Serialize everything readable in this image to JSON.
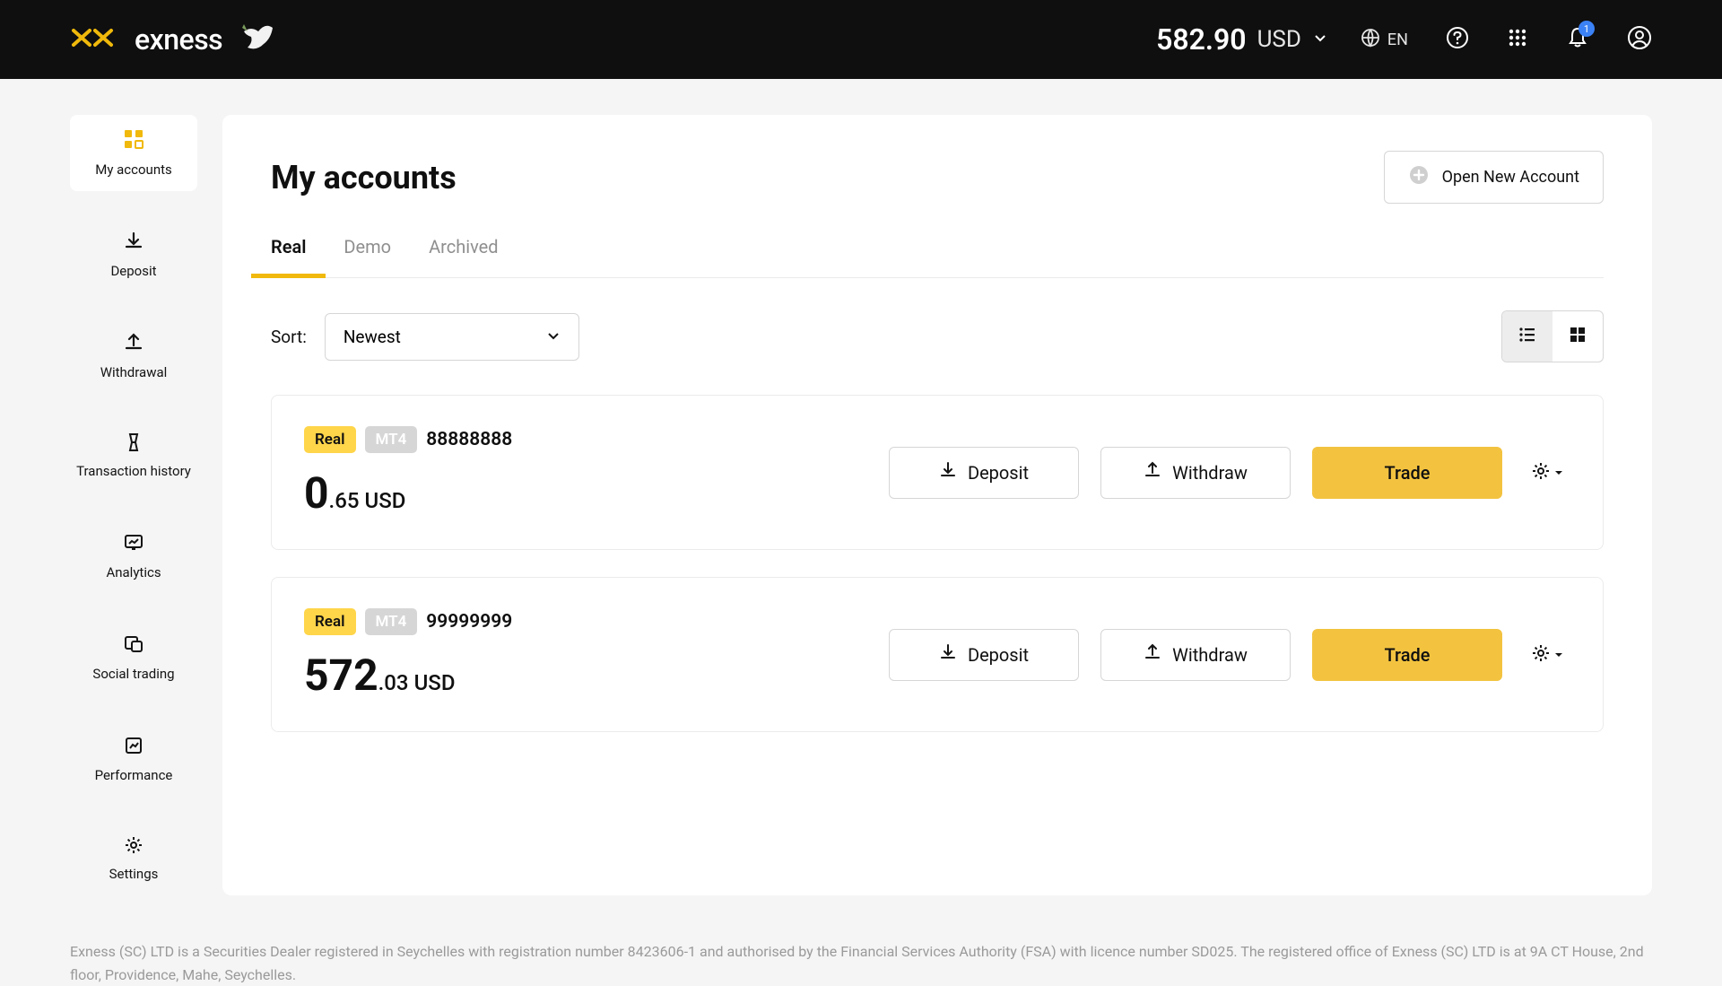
{
  "header": {
    "brand": "exness",
    "balance_amount": "582.90",
    "balance_currency": "USD",
    "lang": "EN",
    "notif_count": "1"
  },
  "sidebar": {
    "items": [
      {
        "label": "My accounts"
      },
      {
        "label": "Deposit"
      },
      {
        "label": "Withdrawal"
      },
      {
        "label": "Transaction history"
      },
      {
        "label": "Analytics"
      },
      {
        "label": "Social trading"
      },
      {
        "label": "Performance"
      },
      {
        "label": "Settings"
      }
    ]
  },
  "page": {
    "title": "My accounts",
    "open_new": "Open New Account",
    "tabs": [
      "Real",
      "Demo",
      "Archived"
    ],
    "sort_label": "Sort:",
    "sort_value": "Newest"
  },
  "accounts": [
    {
      "type_tag": "Real",
      "platform_tag": "MT4",
      "id": "88888888",
      "balance_int": "0",
      "balance_dec": ".65",
      "currency": "USD",
      "deposit": "Deposit",
      "withdraw": "Withdraw",
      "trade": "Trade"
    },
    {
      "type_tag": "Real",
      "platform_tag": "MT4",
      "id": "99999999",
      "balance_int": "572",
      "balance_dec": ".03",
      "currency": "USD",
      "deposit": "Deposit",
      "withdraw": "Withdraw",
      "trade": "Trade"
    }
  ],
  "footer": "Exness (SC) LTD is a Securities Dealer registered in Seychelles with registration number 8423606-1 and authorised by the Financial Services Authority (FSA) with licence number SD025. The registered office of Exness (SC) LTD is at 9A CT House, 2nd floor, Providence, Mahe, Seychelles."
}
